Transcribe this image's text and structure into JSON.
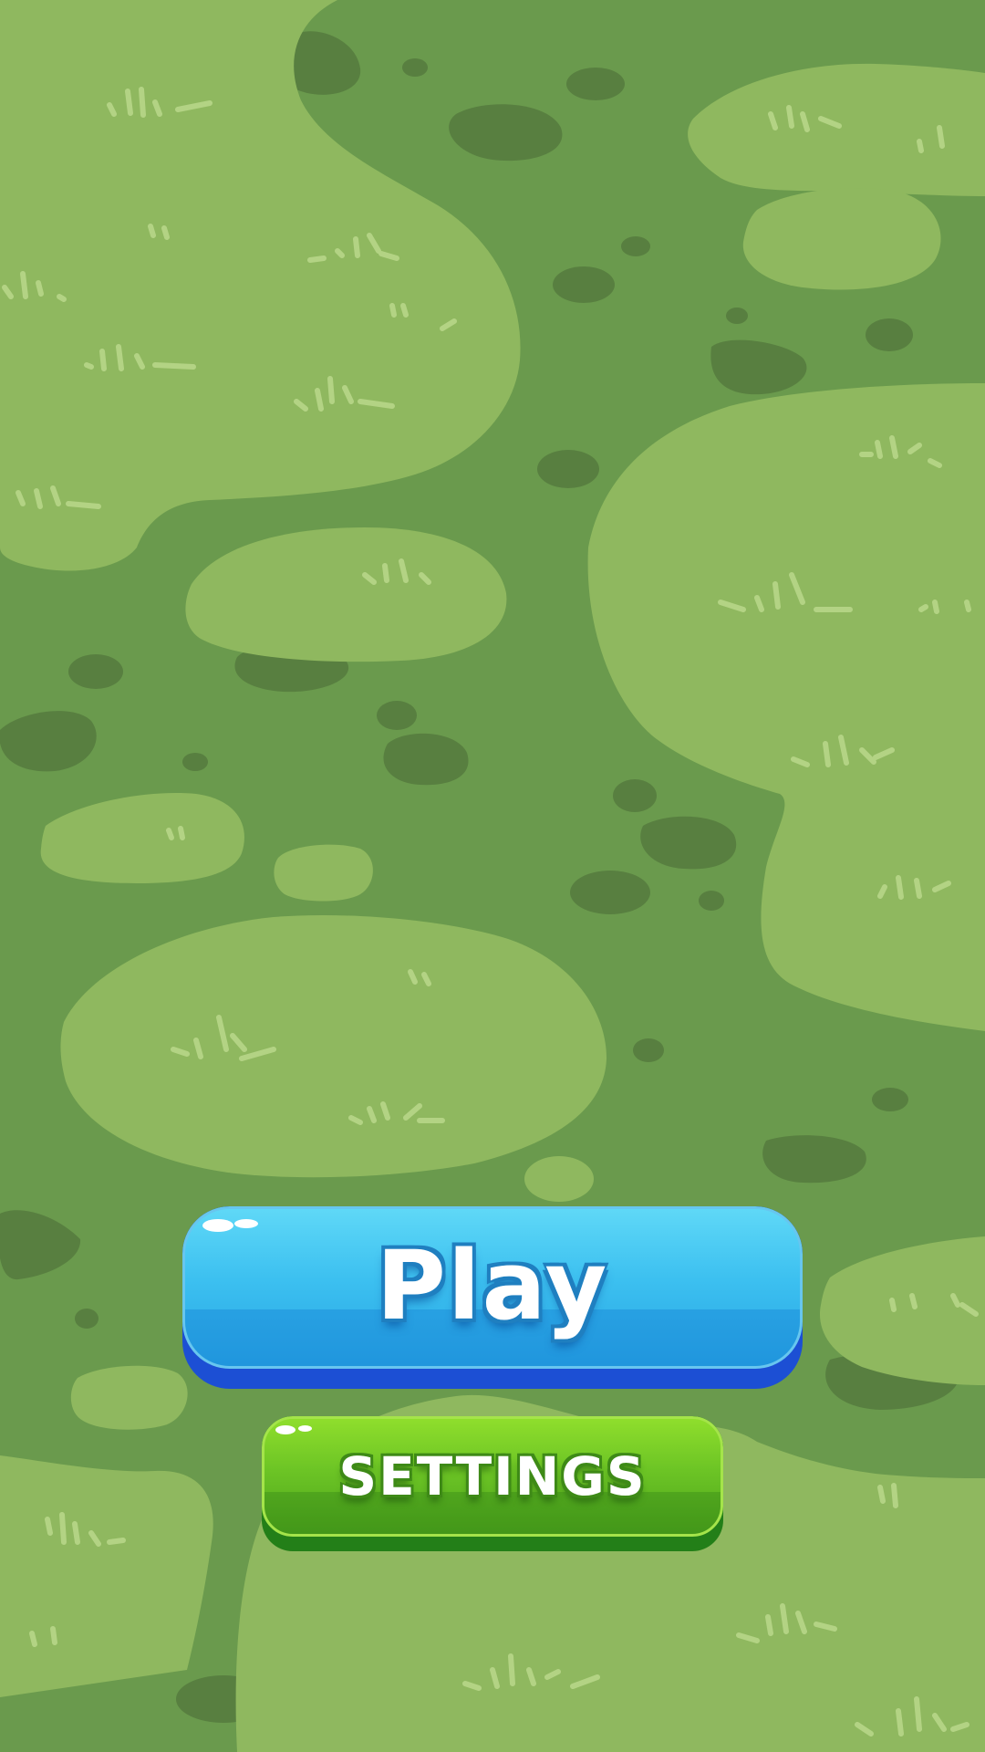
{
  "colors": {
    "background": "#6a9a4d",
    "grass_patch": "#8fb85f",
    "grass_patch_light": "#97bf63",
    "dirt_spot": "#587f40",
    "grass_tuft": "#b3d384",
    "play_button_face": "#3cc0f0",
    "play_button_base": "#1c4fd4",
    "settings_button_face": "#6cc425",
    "settings_button_base": "#237f18",
    "button_text": "#ffffff"
  },
  "menu": {
    "play_label": "Play",
    "settings_label": "SETTINGS"
  }
}
